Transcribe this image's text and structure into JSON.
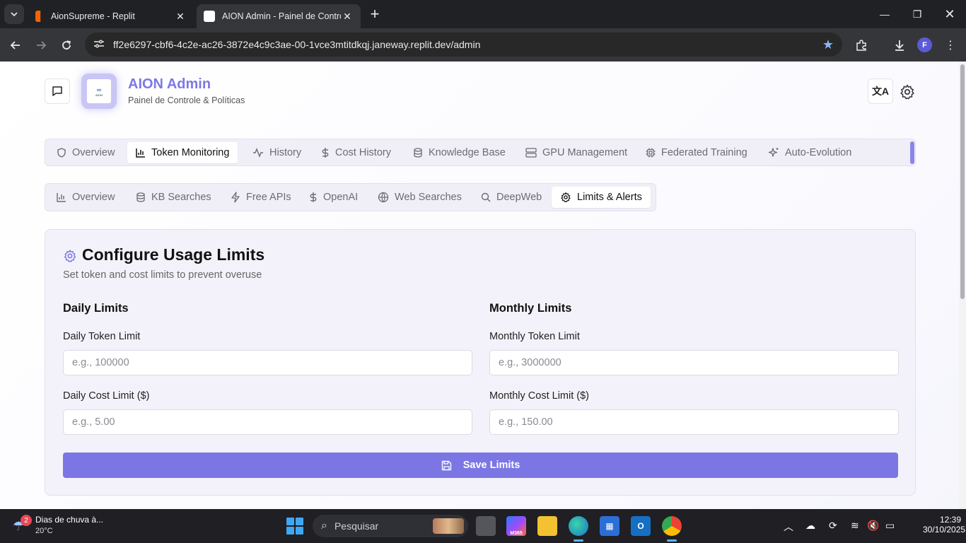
{
  "browser": {
    "tabs": [
      {
        "title": "AionSupreme - Replit"
      },
      {
        "title": "AION Admin - Painel de Contro"
      }
    ],
    "url": "ff2e6297-cbf6-4c2e-ac26-3872e4c9c3ae-00-1vce3mtitdkqj.janeway.replit.dev/admin",
    "profile_initial": "F"
  },
  "header": {
    "logo_text": "AION",
    "title": "AION Admin",
    "subtitle": "Painel de Controle & Políticas",
    "lang_button": "文A"
  },
  "main_tabs": [
    {
      "label": "Overview",
      "icon": "shield-icon"
    },
    {
      "label": "Token Monitoring",
      "icon": "bar-chart-icon",
      "selected": true
    },
    {
      "label": "History",
      "icon": "activity-icon"
    },
    {
      "label": "Cost History",
      "icon": "dollar-icon"
    },
    {
      "label": "Knowledge Base",
      "icon": "database-icon"
    },
    {
      "label": "GPU Management",
      "icon": "server-icon"
    },
    {
      "label": "Federated Training",
      "icon": "cpu-icon"
    },
    {
      "label": "Auto-Evolution",
      "icon": "sparkles-icon"
    }
  ],
  "sub_tabs": [
    {
      "label": "Overview",
      "icon": "bar-chart-icon"
    },
    {
      "label": "KB Searches",
      "icon": "database-icon"
    },
    {
      "label": "Free APIs",
      "icon": "zap-icon"
    },
    {
      "label": "OpenAI",
      "icon": "dollar-icon"
    },
    {
      "label": "Web Searches",
      "icon": "globe-icon"
    },
    {
      "label": "DeepWeb",
      "icon": "search-icon"
    },
    {
      "label": "Limits & Alerts",
      "icon": "gear-icon",
      "selected": true
    }
  ],
  "card": {
    "title": "Configure Usage Limits",
    "description": "Set token and cost limits to prevent overuse",
    "daily": {
      "heading": "Daily Limits",
      "token_label": "Daily Token Limit",
      "token_placeholder": "e.g., 100000",
      "cost_label": "Daily Cost Limit ($)",
      "cost_placeholder": "e.g., 5.00"
    },
    "monthly": {
      "heading": "Monthly Limits",
      "token_label": "Monthly Token Limit",
      "token_placeholder": "e.g., 3000000",
      "cost_label": "Monthly Cost Limit ($)",
      "cost_placeholder": "e.g., 150.00"
    },
    "save_label": "Save Limits"
  },
  "taskbar": {
    "weather_badge": "2",
    "weather_text": "Dias de chuva à...",
    "weather_temp": "20°C",
    "search_placeholder": "Pesquisar",
    "m365_label": "M365",
    "time": "12:39",
    "date": "30/10/2025"
  },
  "colors": {
    "accent": "#7b76e4",
    "brand_title": "#7d78e6"
  }
}
